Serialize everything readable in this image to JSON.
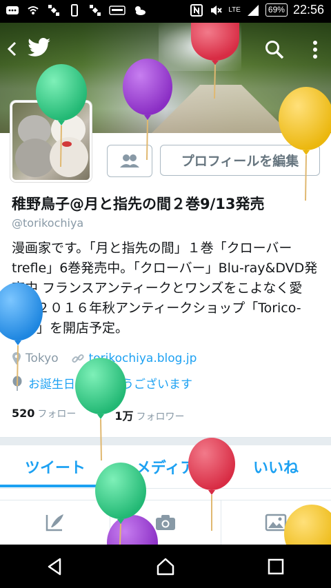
{
  "status_bar": {
    "network": "LTE",
    "battery": "69%",
    "time": "22:56"
  },
  "header": {
    "back_icon": "chevron-left-icon",
    "logo_icon": "twitter-bird-icon",
    "search_icon": "search-icon",
    "more_icon": "more-vert-icon"
  },
  "profile": {
    "name": "稚野鳥子@月と指先の間２巻9/13発売",
    "handle": "@torikochiya",
    "edit_button": "プロフィールを編集",
    "bio": "漫画家です。「月と指先の間」１巻「クローバーtrefle」6巻発売中。「クローバー」Blu-ray&DVD発売中 フランスアンティークとワンズをこよなく愛す。２０１６年秋アンティークショップ「Torico-lore」を開店予定。",
    "location": "Tokyo",
    "website": "torikochiya.blog.jp",
    "birthday_message": "お誕生日おめでとうございます",
    "following_count": "520",
    "following_label": "フォロー",
    "followers_count": "1万",
    "followers_label": "フォロワー"
  },
  "tabs": [
    {
      "label": "ツイート"
    },
    {
      "label": "メディア"
    },
    {
      "label": "いいね"
    }
  ],
  "colors": {
    "accent": "#1da1f2",
    "balloon_green": "#3fd18b",
    "balloon_purple": "#9b3fd1",
    "balloon_red": "#e8374f",
    "balloon_yellow": "#f5c51a",
    "balloon_blue": "#2f9bf0"
  }
}
